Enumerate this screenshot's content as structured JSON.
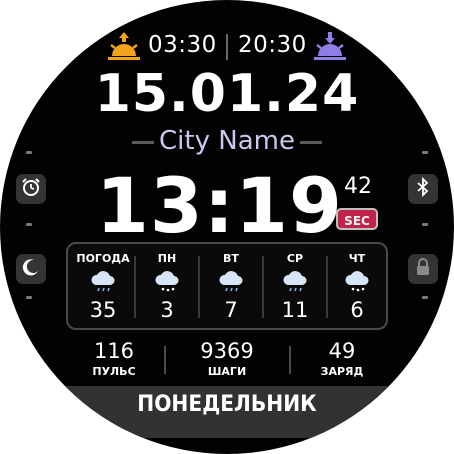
{
  "sunrise": {
    "time": "03:30",
    "icon": "sunrise-icon",
    "color": "#f3a21b"
  },
  "sunset": {
    "time": "20:30",
    "icon": "sunset-icon",
    "color": "#8e7ee6"
  },
  "date": "15.01.24",
  "city": "City Name",
  "time": {
    "hm": "13:19",
    "seconds": "42",
    "sec_badge": "SEC"
  },
  "left_buttons": [
    {
      "icon": "alarm-icon"
    },
    {
      "icon": "moon-icon"
    }
  ],
  "right_buttons": [
    {
      "icon": "bluetooth-icon"
    },
    {
      "icon": "lock-icon"
    }
  ],
  "forecast": [
    {
      "label": "ПОГОДА",
      "temp": "35",
      "icon": "rain-cloud-icon"
    },
    {
      "label": "ПН",
      "temp": "3",
      "icon": "snow-cloud-icon"
    },
    {
      "label": "ВТ",
      "temp": "7",
      "icon": "rain-cloud-icon"
    },
    {
      "label": "СР",
      "temp": "11",
      "icon": "rain-cloud-icon"
    },
    {
      "label": "ЧТ",
      "temp": "6",
      "icon": "snow-cloud-icon"
    }
  ],
  "stats": [
    {
      "value": "116",
      "label": "ПУЛЬС"
    },
    {
      "value": "9369",
      "label": "ШАГИ"
    },
    {
      "value": "49",
      "label": "ЗАРЯД"
    }
  ],
  "weekday": "ПОНЕДЕЛЬНИК",
  "colors": {
    "background": "#020202",
    "city_text": "#c9c9f0",
    "sec_badge": "#c0244a",
    "panel": "#323232"
  }
}
